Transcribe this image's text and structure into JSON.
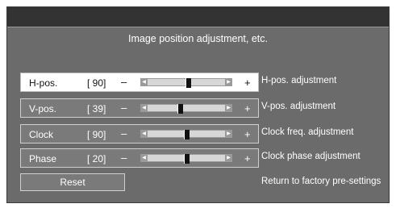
{
  "menu": {
    "heading": "Image position adjustment, etc.",
    "rows": [
      {
        "name": "H-pos.",
        "value": "[ 90]",
        "minus": "–",
        "plus": "+",
        "level": 0.52,
        "description": "H-pos. adjustment",
        "selected": true
      },
      {
        "name": "V-pos.",
        "value": "[ 39]",
        "minus": "–",
        "plus": "+",
        "level": 0.41,
        "description": "V-pos. adjustment",
        "selected": false
      },
      {
        "name": "Clock",
        "value": "[ 90]",
        "minus": "–",
        "plus": "+",
        "level": 0.5,
        "description": "Clock freq. adjustment",
        "selected": false
      },
      {
        "name": "Phase",
        "value": "[ 20]",
        "minus": "–",
        "plus": "+",
        "level": 0.5,
        "description": "Clock phase adjustment",
        "selected": false
      }
    ],
    "reset": {
      "label": "Reset",
      "description": "Return to factory pre-settings"
    }
  },
  "colors": {
    "panel": "#6b6b6b",
    "titlebar": "#333333",
    "selected_row": "#ffffff"
  }
}
